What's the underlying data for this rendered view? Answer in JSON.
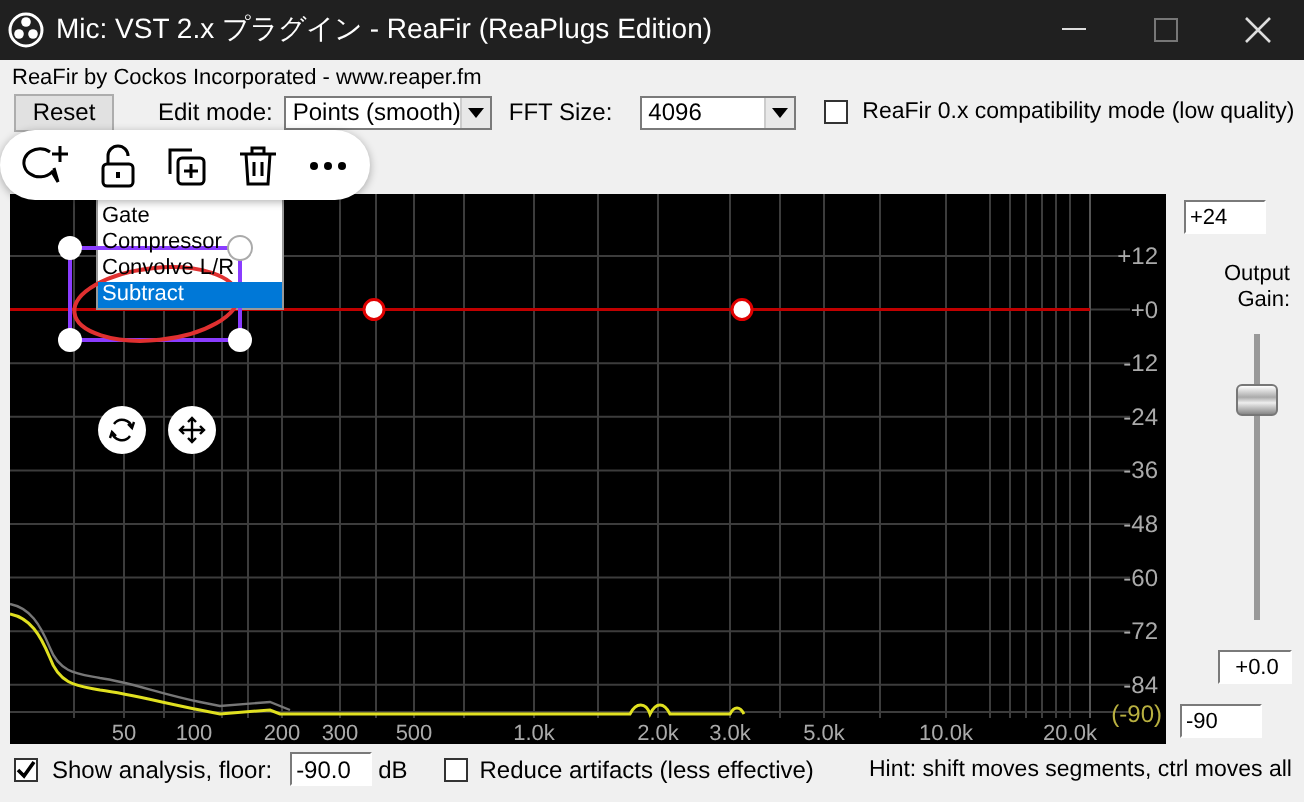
{
  "window": {
    "title": "Mic: VST 2.x プラグイン - ReaFir (ReaPlugs Edition)"
  },
  "group_label": "ReaFir by Cockos Incorporated - www.reaper.fm",
  "controls": {
    "reset": "Reset",
    "edit_mode": {
      "label": "Edit mode:",
      "value": "Points (smooth)"
    },
    "fft_size": {
      "label": "FFT Size:",
      "value": "4096"
    },
    "compat": {
      "label": "ReaFir 0.x compatibility mode (low quality)",
      "checked": false
    }
  },
  "graph": {
    "y_labels": [
      "+12",
      "+0",
      "-12",
      "-24",
      "-36",
      "-48",
      "-60",
      "-72",
      "-84"
    ],
    "floor_label": "(-90)",
    "x_labels": [
      "50",
      "100",
      "200",
      "300",
      "500",
      "1.0k",
      "2.0k",
      "3.0k",
      "5.0k",
      "10.0k",
      "20.0k"
    ]
  },
  "mode_menu": {
    "items": [
      {
        "label": "Gate",
        "selected": false
      },
      {
        "label": "Compressor",
        "selected": false
      },
      {
        "label": "Convolve L/R",
        "selected": false
      },
      {
        "label": "Subtract",
        "selected": true
      }
    ]
  },
  "output": {
    "max": "+24",
    "label": "Output Gain:",
    "level": 0.77,
    "value": "+0.0",
    "min": "-90"
  },
  "bottom": {
    "show_analysis": {
      "label": "Show analysis, floor:",
      "checked": true,
      "value": "-90.0",
      "unit": "dB"
    },
    "reduce": {
      "label": "Reduce artifacts (less effective)",
      "checked": false
    },
    "hint": "Hint: shift moves segments, ctrl moves all"
  }
}
